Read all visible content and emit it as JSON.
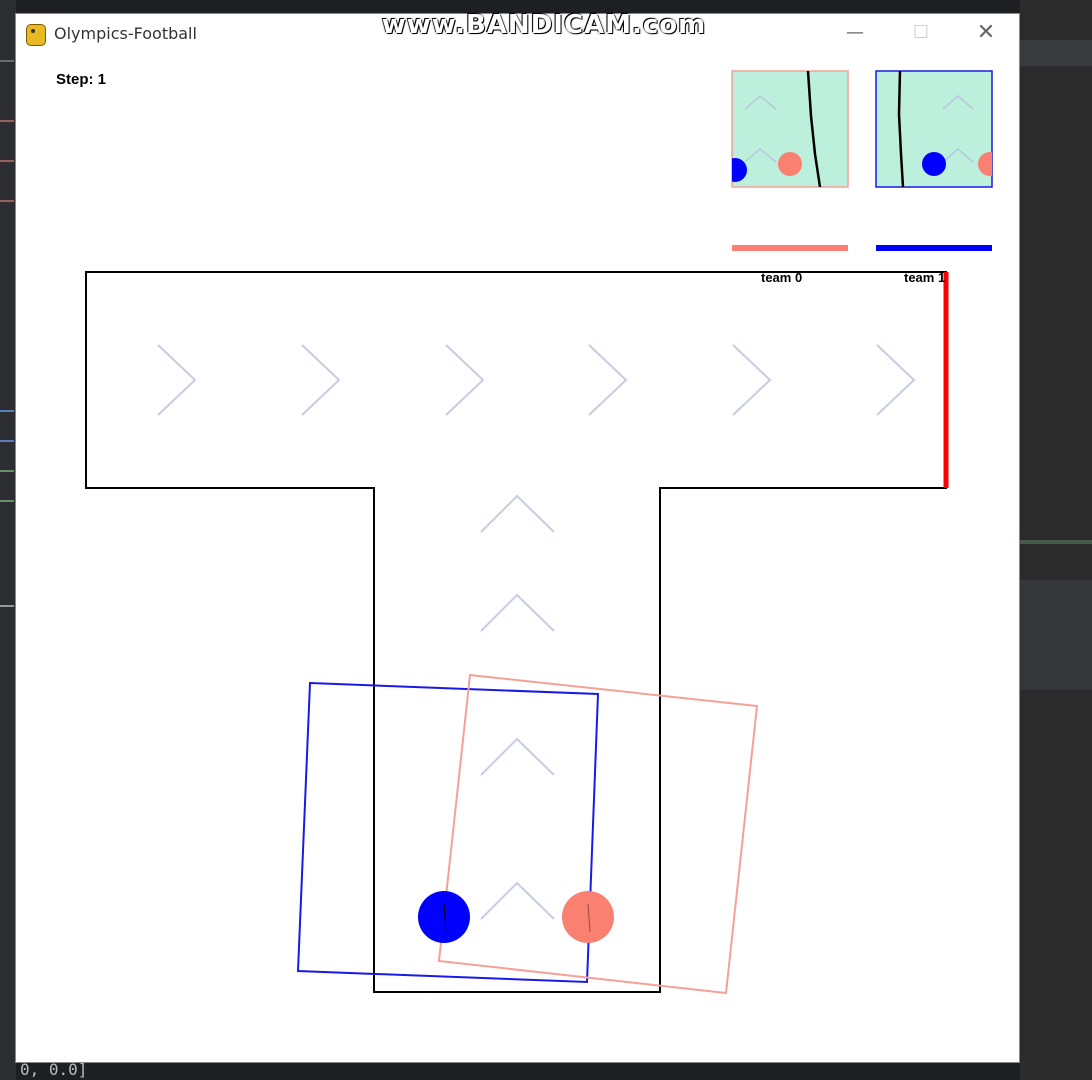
{
  "window": {
    "title": "Olympics-Football"
  },
  "watermark": "www.BANDICAM.com",
  "hud": {
    "step": "Step: 1"
  },
  "teams": [
    {
      "label": "team 0",
      "color": "#fa8072"
    },
    {
      "label": "team 1",
      "color": "#0000ff"
    }
  ],
  "map": {
    "wall_color": "#000000",
    "goal_color": "#ff0000",
    "arrow_color": "#c6cde3",
    "view_bg": "#bcefdc"
  },
  "agents": [
    {
      "team": "team 0",
      "color": "#fa8072"
    },
    {
      "team": "team 1",
      "color": "#0000ff"
    }
  ],
  "background": {
    "console_text": "0, 0.0]"
  }
}
